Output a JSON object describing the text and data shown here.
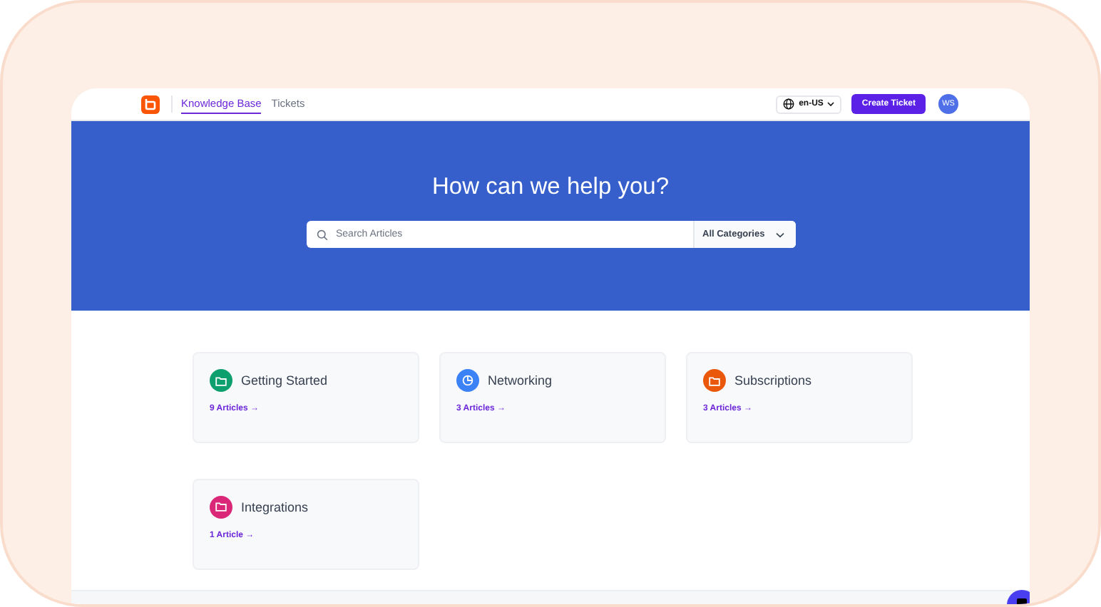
{
  "header": {
    "tabs": [
      {
        "label": "Knowledge Base",
        "selected": true
      },
      {
        "label": "Tickets",
        "selected": false
      }
    ],
    "language": "en-US",
    "create_button": "Create Ticket",
    "avatar": "WS"
  },
  "hero": {
    "title": "How can we help you?",
    "search": {
      "placeholder": "Search Articles"
    },
    "category_filter": "All Categories"
  },
  "categories": [
    {
      "title": "Getting Started",
      "count": "9 Articles",
      "arrow": "→",
      "color": "#0e9f6e",
      "kind": "folder"
    },
    {
      "title": "Networking",
      "count": "3 Articles",
      "arrow": "→",
      "color": "#3b82f6",
      "kind": "pie"
    },
    {
      "title": "Subscriptions",
      "count": "3 Articles",
      "arrow": "→",
      "color": "#ea580c",
      "kind": "folder"
    },
    {
      "title": "Integrations",
      "count": "1 Article",
      "arrow": "→",
      "color": "#db2777",
      "kind": "folder"
    }
  ]
}
